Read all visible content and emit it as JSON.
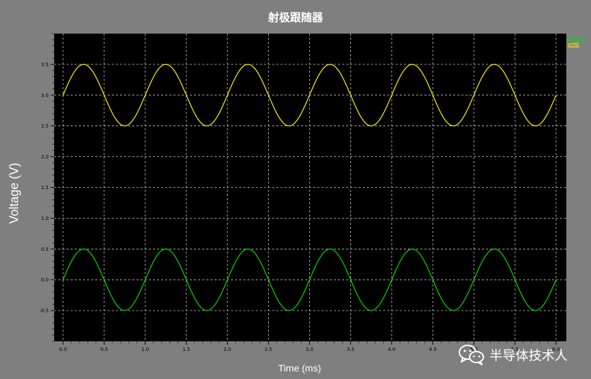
{
  "chart_data": {
    "type": "line",
    "title": "射极跟随器",
    "xlabel": "Time (ms)",
    "ylabel": "Voltage (V)",
    "xlim": [
      0,
      6
    ],
    "ylim": [
      -1,
      4
    ],
    "xticks": [
      "0.0",
      "0.5",
      "1.0",
      "1.5",
      "2.0",
      "2.5",
      "3.0",
      "3.5",
      "4.0",
      "4.5",
      "5.0",
      "5.5",
      "6.0"
    ],
    "yticks": [
      "-0.5",
      "0.0",
      "0.5",
      "1.0",
      "1.5",
      "2.0",
      "2.5",
      "3.0",
      "3.5"
    ],
    "grid": true,
    "legend_position": "top-right",
    "series": [
      {
        "name": "v(OUT)",
        "color": "#00e000",
        "x": [
          0,
          0.25,
          0.5,
          0.75,
          1.0,
          1.25,
          1.5,
          1.75,
          2.0,
          2.25,
          2.5,
          2.75,
          3.0,
          3.25,
          3.5,
          3.75,
          4.0,
          4.25,
          4.5,
          4.75,
          5.0,
          5.25,
          5.5,
          5.75,
          6.0
        ],
        "y": [
          0,
          0.5,
          0,
          -0.5,
          0,
          0.5,
          0,
          -0.5,
          0,
          0.5,
          0,
          -0.5,
          0,
          0.5,
          0,
          -0.5,
          0,
          0.5,
          0,
          -0.5,
          0,
          0.5,
          0,
          -0.5,
          0
        ]
      },
      {
        "name": "v(IN)",
        "color": "#ffff00",
        "x": [
          0,
          0.25,
          0.5,
          0.75,
          1.0,
          1.25,
          1.5,
          1.75,
          2.0,
          2.25,
          2.5,
          2.75,
          3.0,
          3.25,
          3.5,
          3.75,
          4.0,
          4.25,
          4.5,
          4.75,
          5.0,
          5.25,
          5.5,
          5.75,
          6.0
        ],
        "y": [
          3.0,
          3.5,
          3.0,
          2.5,
          3.0,
          3.5,
          3.0,
          2.5,
          3.0,
          3.5,
          3.0,
          2.5,
          3.0,
          3.5,
          3.0,
          2.5,
          3.0,
          3.5,
          3.0,
          2.5,
          3.0,
          3.5,
          3.0,
          2.5,
          3.0
        ]
      }
    ]
  },
  "colors": {
    "background": "#7f7f7f",
    "plot_background": "#000000",
    "grid": "#c8c8c8",
    "axis_text": "#000000"
  },
  "watermark": {
    "text": "半导体技术人",
    "icon": "wechat-icon"
  }
}
